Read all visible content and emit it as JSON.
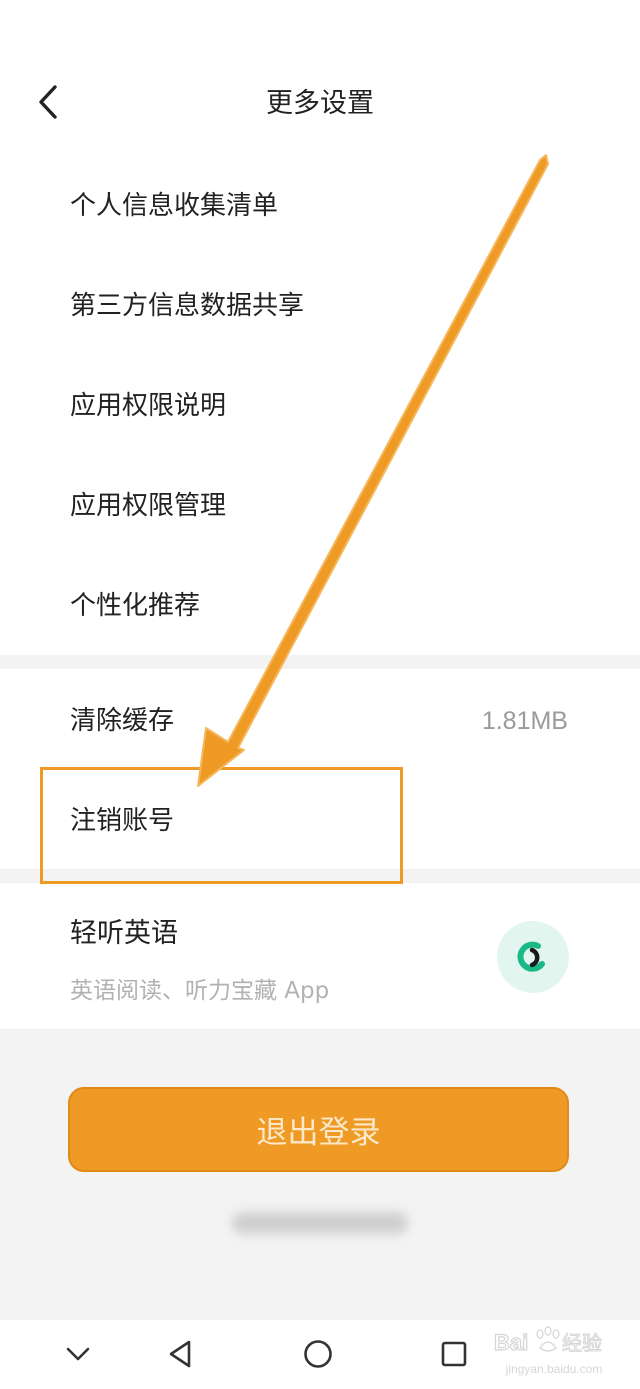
{
  "header": {
    "title": "更多设置"
  },
  "group1": {
    "items": [
      {
        "label": "个人信息收集清单"
      },
      {
        "label": "第三方信息数据共享"
      },
      {
        "label": "应用权限说明"
      },
      {
        "label": "应用权限管理"
      },
      {
        "label": "个性化推荐"
      }
    ]
  },
  "group2": {
    "items": [
      {
        "label": "清除缓存",
        "value": "1.81MB"
      },
      {
        "label": "注销账号"
      }
    ]
  },
  "promo": {
    "title": "轻听英语",
    "subtitle": "英语阅读、听力宝藏 App"
  },
  "logout": {
    "label": "退出登录"
  },
  "watermark": {
    "brand": "Baidu经验",
    "site": "jingyan.baidu.com"
  },
  "colors": {
    "accent": "#ee9a25",
    "app_icon_bg": "#e2f6ef",
    "app_icon_green": "#1bb888"
  },
  "icons": {
    "back": "chevron-left-icon",
    "nav_down": "chevron-down-icon",
    "nav_back": "triangle-back-icon",
    "nav_home": "circle-home-icon",
    "nav_recents": "square-recents-icon"
  }
}
